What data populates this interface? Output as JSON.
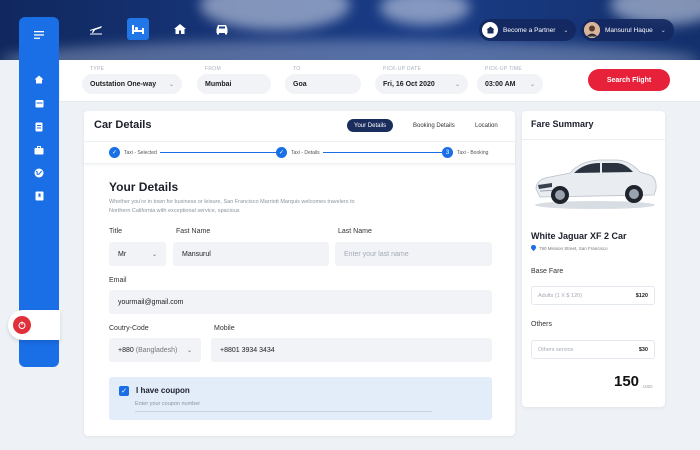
{
  "header": {
    "nav": [
      {
        "icon": "plane-icon",
        "active": false
      },
      {
        "icon": "hotel-bed-icon",
        "active": true
      },
      {
        "icon": "home-icon",
        "active": false
      },
      {
        "icon": "car-icon",
        "active": false
      }
    ],
    "partner_label": "Become a Partner",
    "user_name": "Mansurul Haque"
  },
  "sidebar": {
    "icons": [
      "menu-icon",
      "home-icon",
      "calendar-icon",
      "document-icon",
      "briefcase-icon",
      "globe-icon",
      "bookmark-icon"
    ]
  },
  "search": {
    "type_label": "TYPE",
    "type_value": "Outstation One-way",
    "from_label": "FROM",
    "from_value": "Mumbai",
    "to_label": "TO",
    "to_value": "Goa",
    "date_label": "PICK-UP DATE",
    "date_value": "Fri, 16 Oct 2020",
    "time_label": "PICK-UP TIME",
    "time_value": "03:00 AM",
    "button": "Search  Flight"
  },
  "details": {
    "title": "Car Details",
    "tabs": [
      "Your Details",
      "Booking Details",
      "Location"
    ],
    "steps": [
      "Taxi - Selected",
      "Taxi - Details",
      "Taxi - Booking"
    ],
    "step3_number": "3",
    "heading": "Your Details",
    "description": "Whether you're in town for business or leisure, San Francisco Marriott Marquis welcomes travelers to Northern California with exceptional service, spacious",
    "title_label": "Title",
    "title_value": "Mr",
    "first_label": "Fast Name",
    "first_value": "Mansurul",
    "last_label": "Last Name",
    "last_placeholder": "Enter your last name",
    "email_label": "Email",
    "email_value": "yourmail@gmail.com",
    "code_label": "Coutry-Code",
    "code_value": "+880",
    "code_country": "(Bangladesh)",
    "mobile_label": "Mobile",
    "mobile_value": "+8801 3934 3434",
    "coupon_label": "I have coupon",
    "coupon_placeholder": "Enter your coupon number"
  },
  "fare": {
    "title": "Fare Summary",
    "car_name": "White Jaguar XF 2 Car",
    "location": "790 Mission Street, San Francisco",
    "base_label": "Base Fare",
    "base_key": "Adults (1 X $ 120)",
    "base_value": "$120",
    "others_label": "Others",
    "others_key": "Others service",
    "others_value": "$30",
    "total": "150",
    "currency": "USD"
  },
  "colors": {
    "brand_blue": "#1a6ee6",
    "navy": "#1a2d5c",
    "cta_red": "#e8213a"
  }
}
